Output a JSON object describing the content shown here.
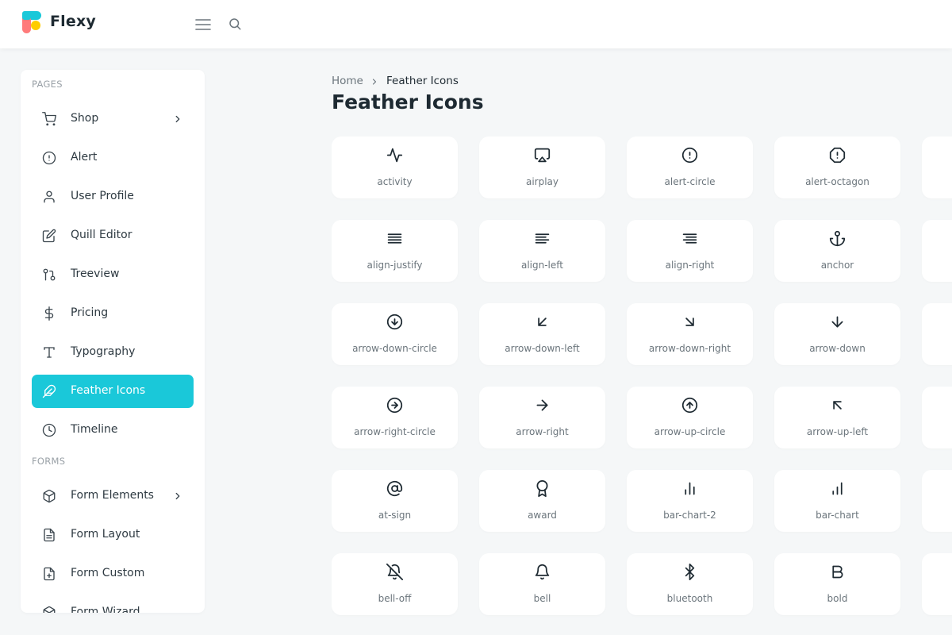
{
  "app": {
    "brand": "Flexy"
  },
  "header": {
    "menu_icon": "menu-icon",
    "search_icon": "search-icon"
  },
  "sidebar": {
    "sections": [
      "PAGES",
      "FORMS"
    ],
    "items": [
      {
        "label": "Shop",
        "icon": "shopping-cart-icon",
        "has_submenu": true
      },
      {
        "label": "Alert",
        "icon": "alert-circle-icon"
      },
      {
        "label": "User Profile",
        "icon": "user-icon"
      },
      {
        "label": "Quill Editor",
        "icon": "edit-icon"
      },
      {
        "label": "Treeview",
        "icon": "git-pull-request-icon"
      },
      {
        "label": "Pricing",
        "icon": "dollar-sign-icon"
      },
      {
        "label": "Typography",
        "icon": "type-icon"
      },
      {
        "label": "Feather Icons",
        "icon": "feather-icon",
        "active": true
      },
      {
        "label": "Timeline",
        "icon": "clock-icon"
      },
      {
        "label": "Form Elements",
        "icon": "box-icon",
        "has_submenu": true
      },
      {
        "label": "Form Layout",
        "icon": "file-text-icon"
      },
      {
        "label": "Form Custom",
        "icon": "file-plus-icon"
      },
      {
        "label": "Form Wizard",
        "icon": "package-icon"
      }
    ]
  },
  "breadcrumb": {
    "home": "Home",
    "current": "Feather Icons"
  },
  "page": {
    "title": "Feather Icons"
  },
  "icons": [
    "activity",
    "airplay",
    "alert-circle",
    "alert-octagon",
    "align-justify",
    "align-left",
    "align-right",
    "anchor",
    "arrow-down-circle",
    "arrow-down-left",
    "arrow-down-right",
    "arrow-down",
    "arrow-right-circle",
    "arrow-right",
    "arrow-up-circle",
    "arrow-up-left",
    "at-sign",
    "award",
    "bar-chart-2",
    "bar-chart",
    "bell-off",
    "bell",
    "bluetooth",
    "bold"
  ],
  "colors": {
    "accent": "#1ac8d9",
    "background": "#f5f7f8",
    "card": "#ffffff",
    "text": "#1e2a32",
    "muted": "#6b757c"
  }
}
